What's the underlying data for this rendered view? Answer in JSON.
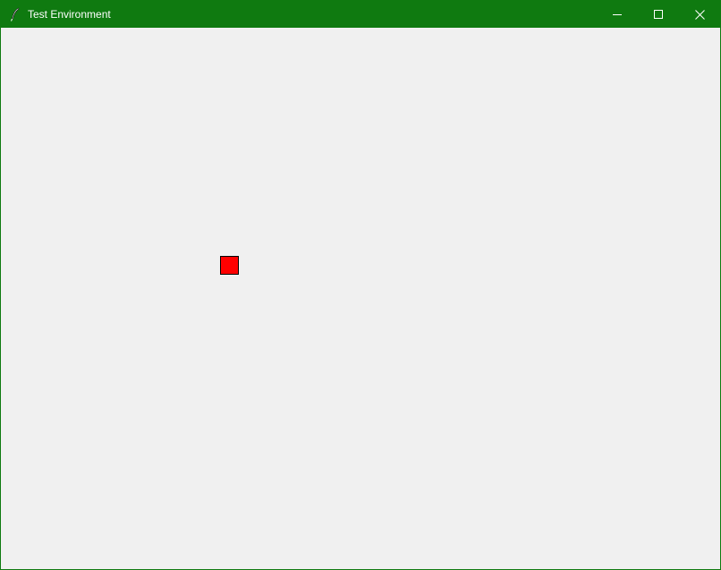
{
  "window": {
    "title": "Test Environment",
    "titlebar_color": "#0f7a10",
    "client_background": "#f0f0f0",
    "app_icon": "feather-icon",
    "controls": {
      "minimize_icon": "minimize-icon",
      "maximize_icon": "maximize-icon",
      "close_icon": "close-icon"
    }
  },
  "canvas": {
    "background": "#f0f0f0",
    "items": [
      {
        "shape": "square",
        "fill": "#ff0000",
        "stroke": "#000000"
      }
    ]
  }
}
